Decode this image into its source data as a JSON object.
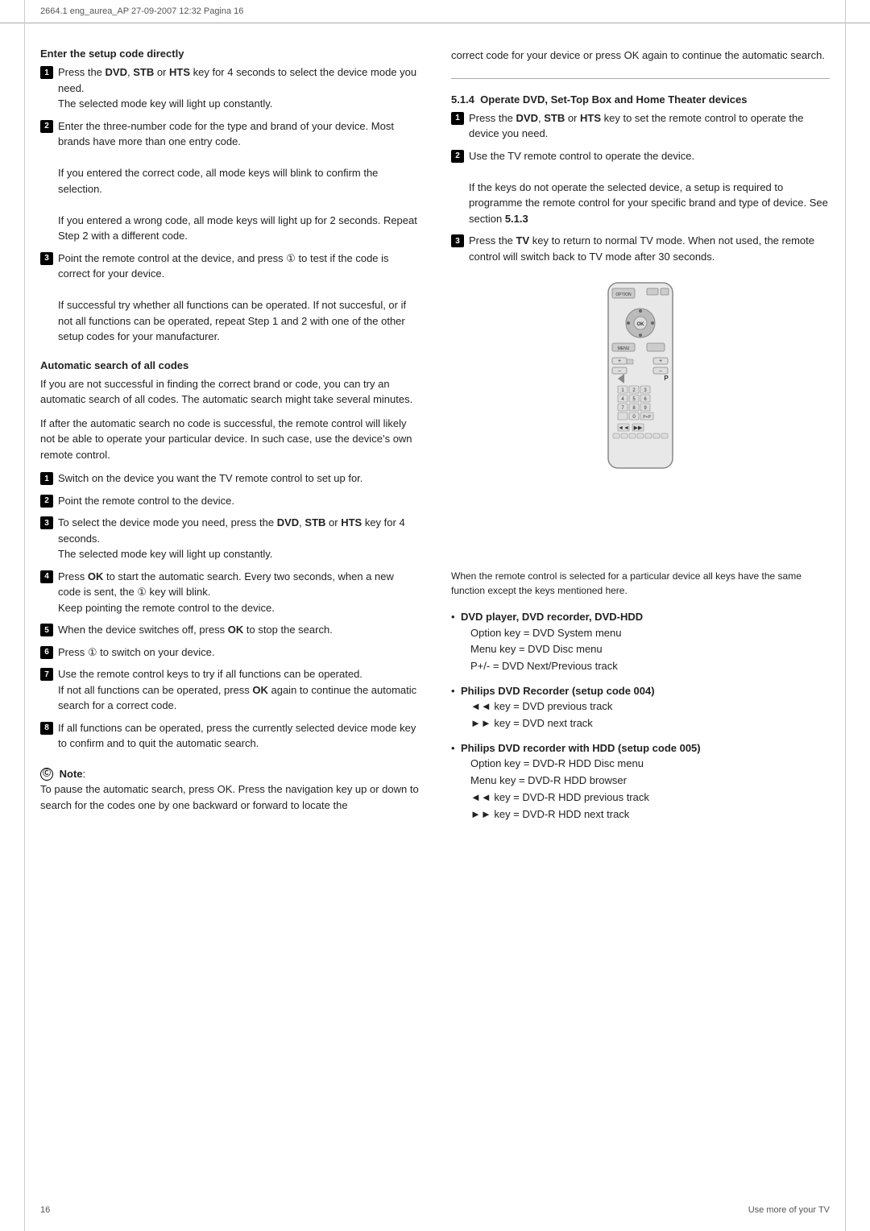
{
  "header": {
    "text": "2664.1  eng_aurea_AP  27-09-2007  12:32  Pagina 16"
  },
  "footer": {
    "left": "16",
    "right": "Use more of your TV"
  },
  "left_col": {
    "section1": {
      "title": "Enter the setup code directly",
      "steps": [
        {
          "num": "1",
          "text": "Press the DVD, STB  or HTS  key for 4 seconds to select the device mode you need.",
          "subtext": "The selected mode key will light up constantly."
        },
        {
          "num": "2",
          "text": "Enter the three-number code for the type and brand of your device. Most brands have more than one entry code.",
          "subtext1": "If you entered the correct code,  all mode keys will blink to confirm the selection.",
          "subtext2": "If you entered a wrong code, all mode keys will light up for 2 seconds. Repeat Step 2 with a different code."
        },
        {
          "num": "3",
          "text": "Point the remote control at the device, and press ① to test if the code is correct for your device.",
          "subtext": "If successful try whether all functions can be operated. If not succesful, or if not all functions can be operated, repeat Step 1 and 2 with one of the other setup codes for your manufacturer."
        }
      ]
    },
    "section2": {
      "title": "Automatic search of all codes",
      "intro1": "If you are not successful in finding the correct brand or code, you can try an automatic search of all codes. The automatic search might take several minutes.",
      "intro2": "If after the automatic search no code is successful, the remote control will likely not be able to operate your particular device. In such case, use the device’s own remote control.",
      "steps": [
        {
          "num": "1",
          "text": "Switch on the device you want the TV remote control to set up for."
        },
        {
          "num": "2",
          "text": "Point the remote control to the device."
        },
        {
          "num": "3",
          "text": "To select the device mode you need, press the DVD, STB or HTS key for 4 seconds.",
          "subtext": "The selected mode key will light up constantly."
        },
        {
          "num": "4",
          "text": "Press OK to start the automatic search. Every two seconds, when a new code is sent, the ① key will blink.",
          "subtext": "Keep pointing the remote control to the device."
        },
        {
          "num": "5",
          "text": "When the device switches off, press OK to stop the search."
        },
        {
          "num": "6",
          "text": "Press ① to switch on your device."
        },
        {
          "num": "7",
          "text": "Use the remote control keys to try if all functions can be operated.",
          "subtext": "If not all functions can be operated, press OK again to continue the automatic search for a correct code."
        },
        {
          "num": "8",
          "text": "If all functions can be operated, press the currently selected device mode key to confirm and to quit the automatic search."
        }
      ]
    },
    "note": {
      "label": "Note",
      "text": "To pause the automatic search, press OK. Press the navigation key up or down to search for the codes one by one backward or forward to locate the"
    }
  },
  "right_col": {
    "note_continued": "correct code for your device or press OK again to continue the automatic search.",
    "section3": {
      "number": "5.1.4",
      "title": "Operate DVD, Set-Top Box and Home Theater devices",
      "steps": [
        {
          "num": "1",
          "text": "Press the DVD, STB or HTS key to set the remote control to operate the device you need."
        },
        {
          "num": "2",
          "text": "Use the TV remote control to operate the device.",
          "subtext": "If the keys do not operate the selected device, a setup is required to programme the remote control for your specific brand and type of device. See section 5.1.3"
        },
        {
          "num": "3",
          "text": "Press the TV key to return to normal TV mode. When not used, the remote control will switch back to TV mode after 30 seconds."
        }
      ]
    },
    "remote_caption": "When the remote control is selected for a particular device all keys have the same function except the keys mentioned here.",
    "bullets": [
      {
        "title": "DVD player, DVD recorder, DVD-HDD",
        "items": [
          "Option key = DVD System menu",
          "Menu key = DVD Disc menu",
          "P+/- = DVD Next/Previous track"
        ]
      },
      {
        "title": "Philips DVD Recorder (setup code 004)",
        "items": [
          "◄◄ key = DVD previous track",
          "►► key = DVD next track"
        ]
      },
      {
        "title": "Philips DVD recorder with HDD (setup code 005)",
        "items": [
          "Option key = DVD-R HDD Disc menu",
          "Menu key = DVD-R HDD browser",
          "◄◄ key = DVD-R HDD previous track",
          "►► key = DVD-R HDD next track"
        ]
      }
    ]
  }
}
